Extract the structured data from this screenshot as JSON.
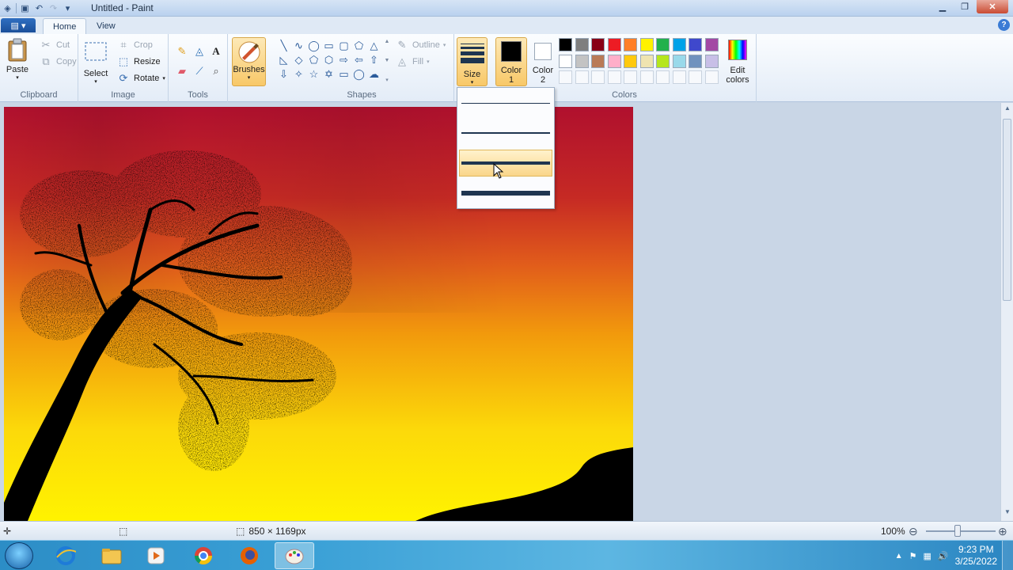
{
  "window": {
    "title": "Untitled - Paint"
  },
  "tabs": {
    "file": "▤ ▾",
    "home": "Home",
    "view": "View"
  },
  "ribbon": {
    "clipboard": {
      "label": "Clipboard",
      "paste": "Paste",
      "cut": "Cut",
      "copy": "Copy"
    },
    "image": {
      "label": "Image",
      "select": "Select",
      "crop": "Crop",
      "resize": "Resize",
      "rotate": "Rotate"
    },
    "tools": {
      "label": "Tools"
    },
    "brushes": {
      "label": "Brushes"
    },
    "shapes": {
      "label": "Shapes",
      "outline": "Outline",
      "fill": "Fill"
    },
    "size": {
      "label": "Size"
    },
    "color1": {
      "line1": "Color",
      "line2": "1",
      "value": "#000000"
    },
    "color2": {
      "line1": "Color",
      "line2": "2",
      "value": "#ffffff"
    },
    "colors": {
      "label": "Colors",
      "edit_line1": "Edit",
      "edit_line2": "colors",
      "palette_row1": [
        "#000000",
        "#7f7f7f",
        "#880015",
        "#ed1c24",
        "#ff7f27",
        "#fff200",
        "#22b14c",
        "#00a2e8",
        "#3f48cc",
        "#a349a4"
      ],
      "palette_row2": [
        "#ffffff",
        "#c3c3c3",
        "#b97a57",
        "#ffaec9",
        "#ffc90e",
        "#efe4b0",
        "#b5e61d",
        "#99d9ea",
        "#7092be",
        "#c8bfe7"
      ]
    }
  },
  "size_menu": {
    "options": [
      1,
      3,
      5,
      8
    ],
    "selected_index": 2
  },
  "status": {
    "dimensions": "850 × 1169px",
    "zoom": "100%"
  },
  "taskbar": {
    "time": "9:23 PM",
    "date": "3/25/2022"
  }
}
